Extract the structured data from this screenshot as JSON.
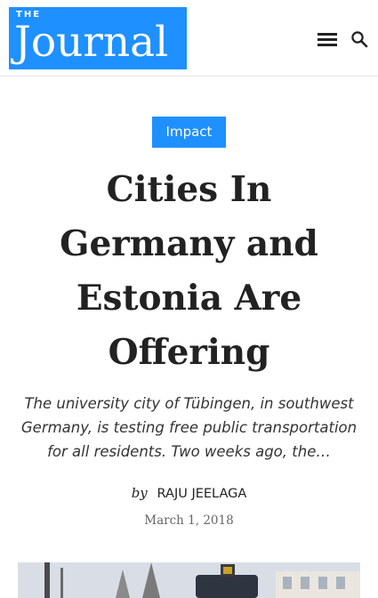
{
  "header": {
    "logo_small": "THE",
    "logo_name": "Journal",
    "menu_icon": "hamburger-menu-icon",
    "search_icon": "search-icon",
    "accent_color": "#1e90ff"
  },
  "article": {
    "category": "Impact",
    "title": "Cities In Germany and Estonia Are Offering",
    "excerpt": "The university city of Tübingen, in southwest Germany, is testing free public transportation for all residents. Two weeks ago, the…",
    "by_label": "by",
    "author": "RAJU JEELAGA",
    "date": "March 1, 2018"
  }
}
